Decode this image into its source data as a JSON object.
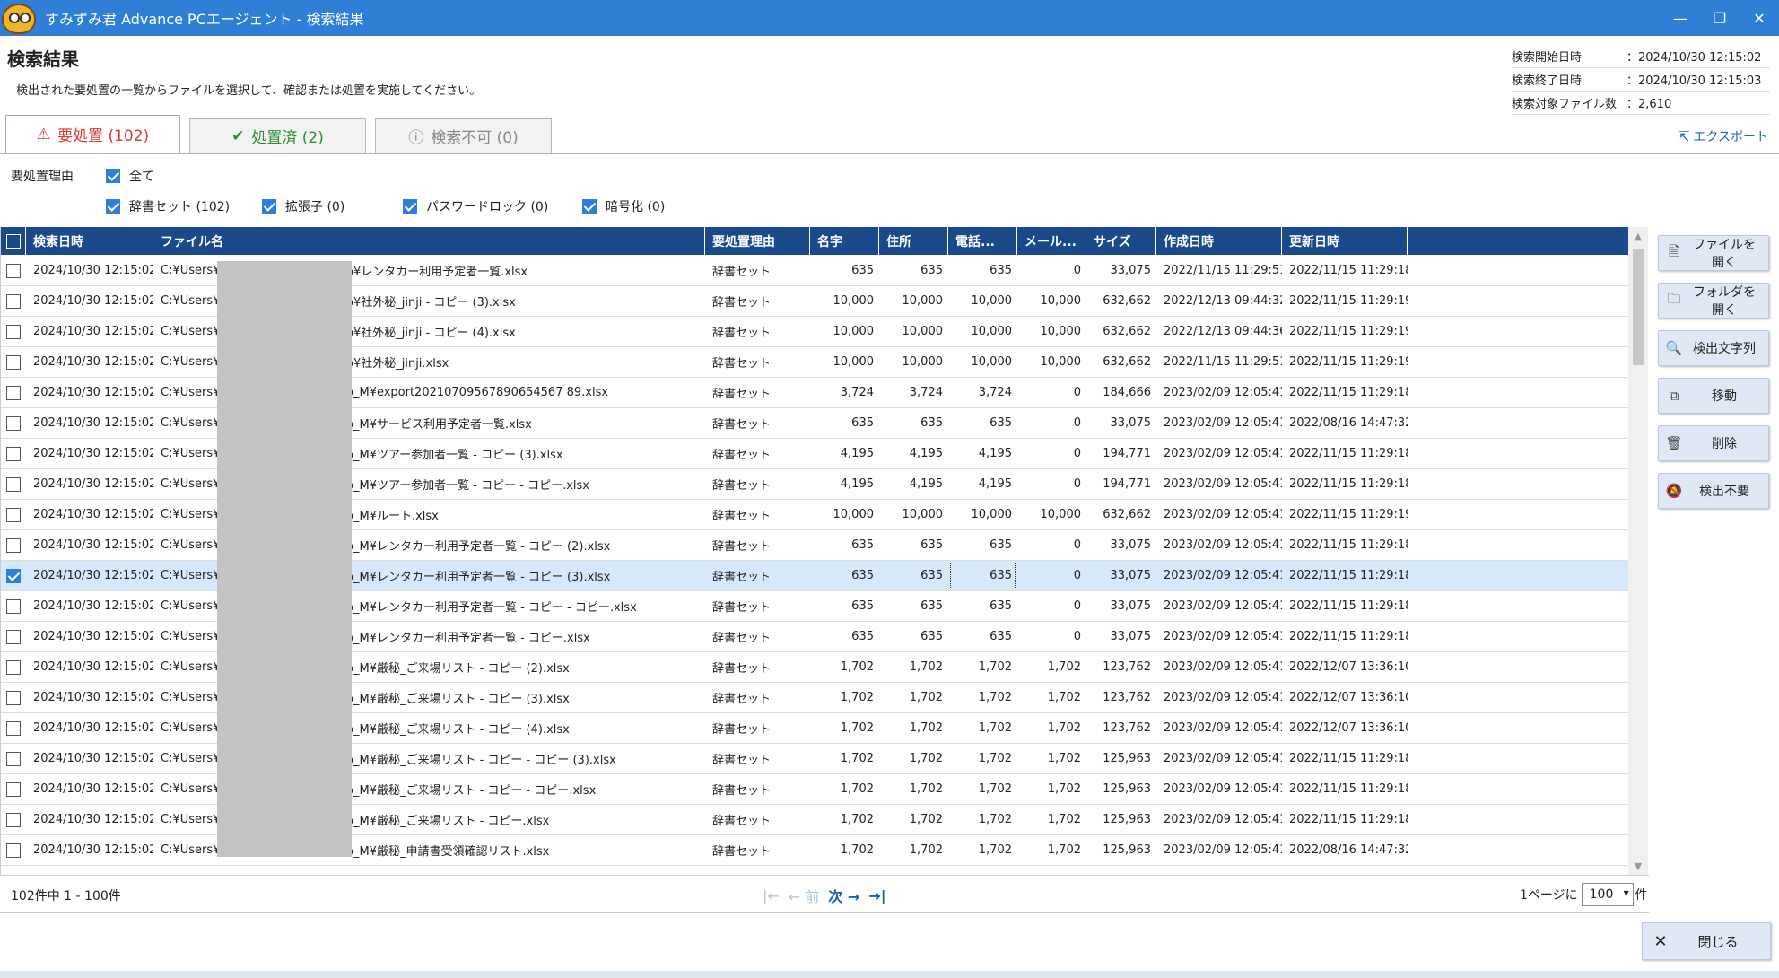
{
  "window": {
    "title": "すみずみ君 Advance PCエージェント - 検索結果",
    "minimize": "—",
    "restore": "❐",
    "close": "✕"
  },
  "page": {
    "title": "検索結果",
    "description": "検出された要処置の一覧からファイルを選択して、確認または処置を実施してください。"
  },
  "meta": [
    {
      "label": "検索開始日時",
      "value": "：2024/10/30 12:15:02"
    },
    {
      "label": "検索終了日時",
      "value": "：2024/10/30 12:15:03"
    },
    {
      "label": "検索対象ファイル数",
      "value": "：2,610"
    }
  ],
  "tabs": [
    {
      "icon": "⚠",
      "label": "要処置 (102)"
    },
    {
      "icon": "✔",
      "label": "処置済 (2)"
    },
    {
      "icon": "ⓘ",
      "label": "検索不可 (0)"
    }
  ],
  "export_label": "エクスポート",
  "filters": {
    "label": "要処置理由",
    "all": "全て",
    "items": [
      "辞書セット (102)",
      "拡張子 (0)",
      "パスワードロック (0)",
      "暗号化 (0)"
    ]
  },
  "columns": [
    "検索日時",
    "ファイル名",
    "要処置理由",
    "名字",
    "住所",
    "電話...",
    "メール...",
    "サイズ",
    "作成日時",
    "更新日時"
  ],
  "rows": [
    [
      "2024/10/30 12:15:02",
      "C:¥Users¥",
      "o¥レンタカー利用予定者一覧.xlsx",
      "辞書セット",
      "635",
      "635",
      "635",
      "0",
      "33,075",
      "2022/11/15 11:29:51",
      "2022/11/15 11:29:18"
    ],
    [
      "2024/10/30 12:15:02",
      "C:¥Users¥",
      "o¥社外秘_jinji - コピー (3).xlsx",
      "辞書セット",
      "10,000",
      "10,000",
      "10,000",
      "10,000",
      "632,662",
      "2022/12/13 09:44:32",
      "2022/11/15 11:29:19"
    ],
    [
      "2024/10/30 12:15:02",
      "C:¥Users¥",
      "o¥社外秘_jinji - コピー (4).xlsx",
      "辞書セット",
      "10,000",
      "10,000",
      "10,000",
      "10,000",
      "632,662",
      "2022/12/13 09:44:36",
      "2022/11/15 11:29:19"
    ],
    [
      "2024/10/30 12:15:02",
      "C:¥Users¥",
      "o¥社外秘_jinji.xlsx",
      "辞書セット",
      "10,000",
      "10,000",
      "10,000",
      "10,000",
      "632,662",
      "2022/11/15 11:29:51",
      "2022/11/15 11:29:19"
    ],
    [
      "2024/10/30 12:15:02",
      "C:¥Users¥",
      "o_M¥export20210709567890654567 89.xlsx",
      "辞書セット",
      "3,724",
      "3,724",
      "3,724",
      "0",
      "184,666",
      "2023/02/09 12:05:41",
      "2022/11/15 11:29:18"
    ],
    [
      "2024/10/30 12:15:02",
      "C:¥Users¥",
      "o_M¥サービス利用予定者一覧.xlsx",
      "辞書セット",
      "635",
      "635",
      "635",
      "0",
      "33,075",
      "2023/02/09 12:05:41",
      "2022/08/16 14:47:32"
    ],
    [
      "2024/10/30 12:15:02",
      "C:¥Users¥",
      "o_M¥ツアー参加者一覧 - コピー (3).xlsx",
      "辞書セット",
      "4,195",
      "4,195",
      "4,195",
      "0",
      "194,771",
      "2023/02/09 12:05:41",
      "2022/11/15 11:29:18"
    ],
    [
      "2024/10/30 12:15:02",
      "C:¥Users¥",
      "o_M¥ツアー参加者一覧 - コピー - コピー.xlsx",
      "辞書セット",
      "4,195",
      "4,195",
      "4,195",
      "0",
      "194,771",
      "2023/02/09 12:05:41",
      "2022/11/15 11:29:18"
    ],
    [
      "2024/10/30 12:15:02",
      "C:¥Users¥",
      "o_M¥ルート.xlsx",
      "辞書セット",
      "10,000",
      "10,000",
      "10,000",
      "10,000",
      "632,662",
      "2023/02/09 12:05:41",
      "2022/11/15 11:29:19"
    ],
    [
      "2024/10/30 12:15:02",
      "C:¥Users¥",
      "o_M¥レンタカー利用予定者一覧 - コピー (2).xlsx",
      "辞書セット",
      "635",
      "635",
      "635",
      "0",
      "33,075",
      "2023/02/09 12:05:41",
      "2022/11/15 11:29:18"
    ],
    [
      "2024/10/30 12:15:02",
      "C:¥Users¥",
      "o_M¥レンタカー利用予定者一覧 - コピー (3).xlsx",
      "辞書セット",
      "635",
      "635",
      "635",
      "0",
      "33,075",
      "2023/02/09 12:05:41",
      "2022/11/15 11:29:18"
    ],
    [
      "2024/10/30 12:15:02",
      "C:¥Users¥",
      "o_M¥レンタカー利用予定者一覧 - コピー - コピー.xlsx",
      "辞書セット",
      "635",
      "635",
      "635",
      "0",
      "33,075",
      "2023/02/09 12:05:41",
      "2022/11/15 11:29:18"
    ],
    [
      "2024/10/30 12:15:02",
      "C:¥Users¥",
      "o_M¥レンタカー利用予定者一覧 - コピー.xlsx",
      "辞書セット",
      "635",
      "635",
      "635",
      "0",
      "33,075",
      "2023/02/09 12:05:41",
      "2022/11/15 11:29:18"
    ],
    [
      "2024/10/30 12:15:02",
      "C:¥Users¥",
      "o_M¥厳秘_ご来場リスト - コピー (2).xlsx",
      "辞書セット",
      "1,702",
      "1,702",
      "1,702",
      "1,702",
      "123,762",
      "2023/02/09 12:05:41",
      "2022/12/07 13:36:10"
    ],
    [
      "2024/10/30 12:15:02",
      "C:¥Users¥",
      "o_M¥厳秘_ご来場リスト - コピー (3).xlsx",
      "辞書セット",
      "1,702",
      "1,702",
      "1,702",
      "1,702",
      "123,762",
      "2023/02/09 12:05:41",
      "2022/12/07 13:36:10"
    ],
    [
      "2024/10/30 12:15:02",
      "C:¥Users¥",
      "o_M¥厳秘_ご来場リスト - コピー (4).xlsx",
      "辞書セット",
      "1,702",
      "1,702",
      "1,702",
      "1,702",
      "123,762",
      "2023/02/09 12:05:41",
      "2022/12/07 13:36:10"
    ],
    [
      "2024/10/30 12:15:02",
      "C:¥Users¥",
      "o_M¥厳秘_ご来場リスト - コピー - コピー (3).xlsx",
      "辞書セット",
      "1,702",
      "1,702",
      "1,702",
      "1,702",
      "125,963",
      "2023/02/09 12:05:41",
      "2022/11/15 11:29:18"
    ],
    [
      "2024/10/30 12:15:02",
      "C:¥Users¥",
      "o_M¥厳秘_ご来場リスト - コピー - コピー.xlsx",
      "辞書セット",
      "1,702",
      "1,702",
      "1,702",
      "1,702",
      "125,963",
      "2023/02/09 12:05:41",
      "2022/11/15 11:29:18"
    ],
    [
      "2024/10/30 12:15:02",
      "C:¥Users¥",
      "o_M¥厳秘_ご来場リスト - コピー.xlsx",
      "辞書セット",
      "1,702",
      "1,702",
      "1,702",
      "1,702",
      "125,963",
      "2023/02/09 12:05:41",
      "2022/11/15 11:29:18"
    ],
    [
      "2024/10/30 12:15:02",
      "C:¥Users¥",
      "o_M¥厳秘_申請書受領確認リスト.xlsx",
      "辞書セット",
      "1,702",
      "1,702",
      "1,702",
      "1,702",
      "125,963",
      "2023/02/09 12:05:41",
      "2022/08/16 14:47:32"
    ]
  ],
  "selected_row": 10,
  "actions": [
    {
      "icon": "🗎",
      "label": "ファイルを開く"
    },
    {
      "icon": "🗀",
      "label": "フォルダを開く"
    },
    {
      "icon": "🔍",
      "label": "検出文字列"
    },
    {
      "icon": "⧉",
      "label": "移動"
    },
    {
      "icon": "🗑",
      "label": "削除"
    },
    {
      "icon": "🔕",
      "label": "検出不要"
    }
  ],
  "pager": {
    "count": "102件中 1 - 100件",
    "first": "|←",
    "prev": "← 前",
    "next": "次 →",
    "last": "→|",
    "per_page_prefix": "1ページに",
    "per_page_value": "100",
    "per_page_suffix": "件"
  },
  "close_label": "閉じる",
  "colors": {
    "titlebar": "#2f7fd6",
    "header": "#1b4a8a",
    "selected_row": "#d6e8fb",
    "tab_alert": "#d63a3a",
    "tab_done": "#2e8b35"
  }
}
